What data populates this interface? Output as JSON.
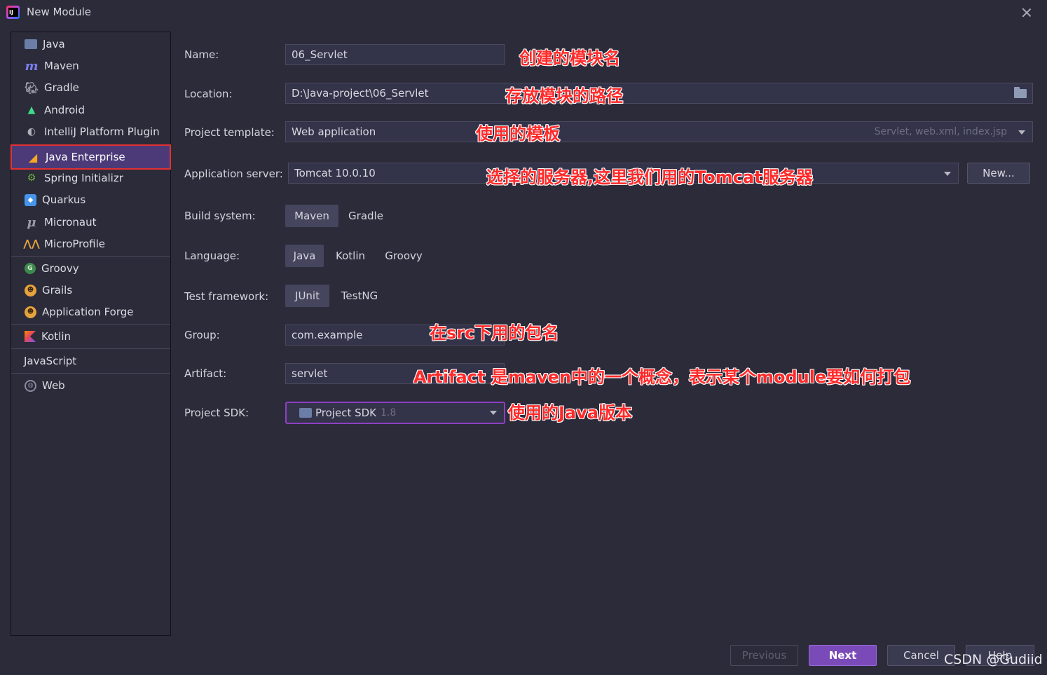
{
  "window": {
    "title": "New Module"
  },
  "sidebar": {
    "items": [
      {
        "label": "Java",
        "icon": "java-folder-icon"
      },
      {
        "label": "Maven",
        "icon": "maven-icon"
      },
      {
        "label": "Gradle",
        "icon": "gradle-icon"
      },
      {
        "label": "Android",
        "icon": "android-icon"
      },
      {
        "label": "IntelliJ Platform Plugin",
        "icon": "plugin-icon"
      },
      {
        "label": "Java Enterprise",
        "icon": "java-enterprise-icon",
        "selected": true
      },
      {
        "label": "Spring Initializr",
        "icon": "spring-icon"
      },
      {
        "label": "Quarkus",
        "icon": "quarkus-icon"
      },
      {
        "label": "Micronaut",
        "icon": "micronaut-icon"
      },
      {
        "label": "MicroProfile",
        "icon": "microprofile-icon"
      },
      {
        "label": "Groovy",
        "icon": "groovy-icon"
      },
      {
        "label": "Grails",
        "icon": "grails-icon"
      },
      {
        "label": "Application Forge",
        "icon": "application-forge-icon"
      },
      {
        "label": "Kotlin",
        "icon": "kotlin-icon"
      },
      {
        "label": "JavaScript",
        "icon": ""
      },
      {
        "label": "Web",
        "icon": "web-icon"
      }
    ]
  },
  "form": {
    "name": {
      "label": "Name:",
      "value": "06_Servlet"
    },
    "location": {
      "label": "Location:",
      "value": "D:\\Java-project\\06_Servlet"
    },
    "project_template": {
      "label": "Project template:",
      "value": "Web application",
      "hint": "Servlet, web.xml, index.jsp"
    },
    "application_server": {
      "label": "Application server:",
      "value": "Tomcat 10.0.10",
      "new_button": "New..."
    },
    "build_system": {
      "label": "Build system:",
      "options": [
        "Maven",
        "Gradle"
      ],
      "selected": "Maven"
    },
    "language": {
      "label": "Language:",
      "options": [
        "Java",
        "Kotlin",
        "Groovy"
      ],
      "selected": "Java"
    },
    "test_framework": {
      "label": "Test framework:",
      "options": [
        "JUnit",
        "TestNG"
      ],
      "selected": "JUnit"
    },
    "group": {
      "label": "Group:",
      "value": "com.example"
    },
    "artifact": {
      "label": "Artifact:",
      "value": "servlet"
    },
    "project_sdk": {
      "label": "Project SDK:",
      "value": "Project SDK",
      "version": "1.8"
    }
  },
  "annotations": {
    "name": "创建的模块名",
    "location": "存放模块的路径",
    "template": "使用的模板",
    "server": "选择的服务器,这里我们用的Tomcat服务器",
    "group": "在src下用的包名",
    "artifact": "Artifact 是maven中的一个概念，表示某个module要如何打包",
    "sdk": "使用的Java版本"
  },
  "footer": {
    "previous": "Previous",
    "next": "Next",
    "cancel": "Cancel",
    "help": "Help"
  },
  "watermark": "CSDN @Gudiid",
  "colors": {
    "background": "#2b2b3a",
    "selection": "#4c3a78",
    "accent": "#7a4ab8",
    "annotation": "#ff2a2a"
  }
}
